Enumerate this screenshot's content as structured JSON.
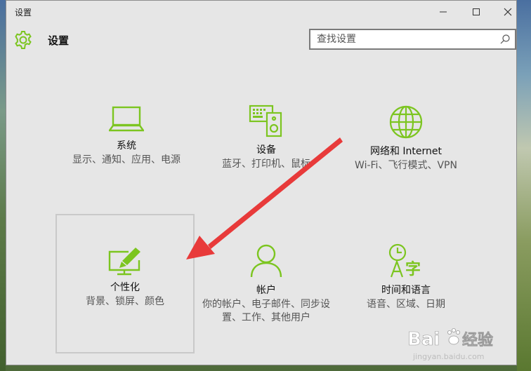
{
  "window": {
    "title": "设置",
    "controls": [
      "minimize",
      "maximize",
      "close"
    ]
  },
  "header": {
    "title": "设置",
    "icon": "gear-icon"
  },
  "search": {
    "placeholder": "查找设置",
    "icon": "search-icon"
  },
  "tiles": [
    {
      "id": "system",
      "name": "系统",
      "desc": "显示、通知、应用、电源",
      "icon": "laptop-icon"
    },
    {
      "id": "devices",
      "name": "设备",
      "desc": "蓝牙、打印机、鼠标",
      "icon": "devices-icon"
    },
    {
      "id": "network",
      "name": "网络和 Internet",
      "desc": "Wi-Fi、飞行模式、VPN",
      "icon": "globe-icon"
    },
    {
      "id": "personalization",
      "name": "个性化",
      "desc": "背景、锁屏、颜色",
      "icon": "personalization-icon",
      "selected": true
    },
    {
      "id": "accounts",
      "name": "帐户",
      "desc": "你的帐户、电子邮件、同步设置、工作、其他用户",
      "icon": "person-icon"
    },
    {
      "id": "time_language",
      "name": "时间和语言",
      "desc": "语音、区域、日期",
      "icon": "time-language-icon"
    }
  ],
  "watermark": {
    "brand": "Bai",
    "brand_suffix": "经验",
    "url": "jingyan.baidu.com"
  },
  "colors": {
    "accent": "#7cc520",
    "window_bg": "#e6e6e6",
    "annotation_arrow": "#e83a3a"
  }
}
